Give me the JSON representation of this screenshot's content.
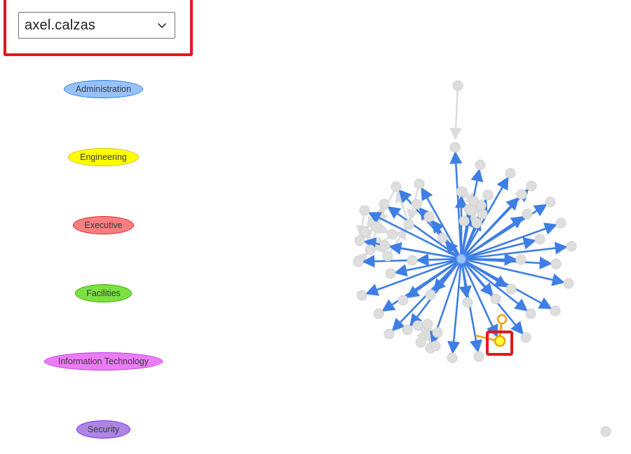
{
  "user_select": {
    "value": "axel.calzas"
  },
  "legend": [
    {
      "label": "Administration",
      "fill": "#97c2fc",
      "border": "#2b7ce9"
    },
    {
      "label": "Engineering",
      "fill": "#ffff00",
      "border": "#d6c300"
    },
    {
      "label": "Executive",
      "fill": "#fb7e81",
      "border": "#e31d1d"
    },
    {
      "label": "Facilities",
      "fill": "#7be141",
      "border": "#41a906"
    },
    {
      "label": "Information Technology",
      "fill": "#eb7df4",
      "border": "#c037df"
    },
    {
      "label": "Security",
      "fill": "#ad85e4",
      "border": "#7c29f0"
    }
  ],
  "colors": {
    "edge_active": "#3f7fe5",
    "edge_muted": "#dcdcdc",
    "node_muted": "#dedede",
    "node_highlight_fill": "#ffff33",
    "node_highlight_border": "#f0a30a",
    "highlight_box": "#e3181f"
  }
}
